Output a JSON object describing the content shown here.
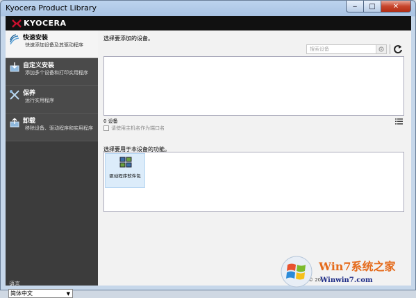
{
  "window": {
    "title": "Kyocera Product Library",
    "min_label": "‒",
    "max_label": "□",
    "close_label": "✕"
  },
  "header": {
    "brand": "KYOCERA"
  },
  "sidebar": {
    "items": [
      {
        "title": "快速安装",
        "desc": "快速添加设备及其驱动程序",
        "icon": "quick-install-icon",
        "active": true
      },
      {
        "title": "自定义安装",
        "desc": "添加多个设备和打印实用程序",
        "icon": "custom-install-icon",
        "active": false
      },
      {
        "title": "保养",
        "desc": "运行实用程序",
        "icon": "maintenance-icon",
        "active": false
      },
      {
        "title": "卸载",
        "desc": "移除设备、驱动程序和实用程序",
        "icon": "uninstall-icon",
        "active": false
      }
    ],
    "language_label": "语言",
    "language_value": "简体中文"
  },
  "main": {
    "select_device_label": "选择要添加的设备。",
    "search_placeholder": "搜索设备",
    "device_count": "0  设备",
    "use_host_name_label": "请使用主机名作为端口名",
    "select_features_label": "选择要用于本设备的功能。",
    "features": [
      {
        "label": "驱动程序软件包",
        "icon": "driver-package-icon"
      }
    ],
    "footer_text": "© 20"
  },
  "watermark": {
    "line1": "Win7系统之家",
    "line2": "Winwin7.com"
  },
  "colors": {
    "accent_red": "#c8102e",
    "header_bg": "#111111",
    "sidebar_bg": "#4a4a4a"
  }
}
